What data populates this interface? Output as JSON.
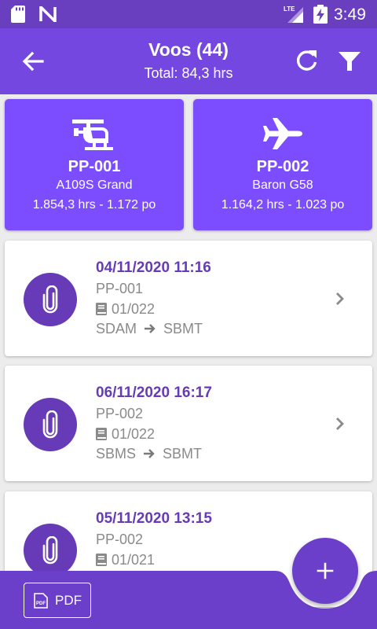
{
  "status_bar": {
    "time": "3:49",
    "icons": [
      "sd-card-icon",
      "n-icon",
      "lte-signal-icon",
      "battery-charging-icon"
    ]
  },
  "app_bar": {
    "title": "Voos (44)",
    "subtitle": "Total: 84,3 hrs",
    "icons": [
      "back-arrow-icon",
      "refresh-icon",
      "filter-icon"
    ]
  },
  "aircraft": [
    {
      "icon": "helicopter-icon",
      "registration": "PP-001",
      "model": "A109S Grand",
      "stats": "1.854,3 hrs - 1.172 po"
    },
    {
      "icon": "airplane-icon",
      "registration": "PP-002",
      "model": "Baron G58",
      "stats": "1.164,2 hrs - 1.023 po"
    }
  ],
  "flights": [
    {
      "datetime": "04/11/2020 11:16",
      "registration": "PP-001",
      "logbook": "01/022",
      "from": "SDAM",
      "to": "SBMT"
    },
    {
      "datetime": "06/11/2020 16:17",
      "registration": "PP-002",
      "logbook": "01/022",
      "from": "SBMS",
      "to": "SBMT"
    },
    {
      "datetime": "05/11/2020 13:15",
      "registration": "PP-002",
      "logbook": "01/021",
      "from": "",
      "to": ""
    }
  ],
  "bottom_bar": {
    "pdf_label": "PDF",
    "fab_icon": "plus-icon"
  },
  "colors": {
    "status_bar": "#6a3fbf",
    "app_bar": "#7448e0",
    "aircraft_card": "#7c4dff",
    "accent": "#673ab7",
    "bottom_bar": "#6b3fc9",
    "background": "#ececec",
    "secondary_text": "#8a8a8a"
  }
}
